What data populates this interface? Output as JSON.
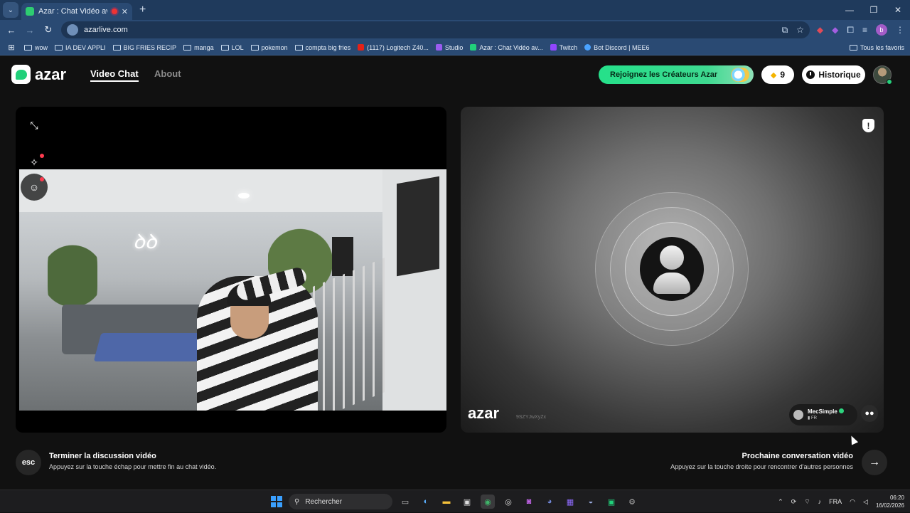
{
  "browser": {
    "tab_title": "Azar : Chat Vidéo avec de n",
    "tab_close": "✕",
    "new_tab": "+",
    "url": "azarlive.com",
    "window_controls": [
      "—",
      "❐",
      "✕"
    ],
    "bookmarks": [
      {
        "label": "wow",
        "icon": "folder-icon"
      },
      {
        "label": "IA DEV APPLI",
        "icon": "folder-icon"
      },
      {
        "label": "BIG FRIES RECIP",
        "icon": "folder-icon"
      },
      {
        "label": "manga",
        "icon": "folder-icon"
      },
      {
        "label": "LOL",
        "icon": "folder-icon"
      },
      {
        "label": "pokemon",
        "icon": "folder-icon"
      },
      {
        "label": "compta big fries",
        "icon": "folder-icon"
      },
      {
        "label": "(1117) Logitech Z40...",
        "icon": "youtube-icon",
        "color": "#e62117"
      },
      {
        "label": "Studio",
        "icon": "studio-icon",
        "color": "#9a5cf0"
      },
      {
        "label": "Azar : Chat Vidéo av...",
        "icon": "azar-icon",
        "color": "#21d07a"
      },
      {
        "label": "Twitch",
        "icon": "twitch-icon",
        "color": "#9146ff"
      },
      {
        "label": "Bot Discord | MEE6",
        "icon": "mee6-icon",
        "color": "#4aa3ff"
      }
    ],
    "all_bookmarks": "Tous les favoris",
    "profile_initial": "b"
  },
  "header": {
    "logo_text": "azar",
    "nav": {
      "video_chat": "Video Chat",
      "about": "About"
    },
    "creators_button": "Rejoignez les Créateurs Azar",
    "gems_count": "9",
    "history_button": "Historique"
  },
  "left_panel": {
    "neon_sign": "ꝺꝺ"
  },
  "right_panel": {
    "watermark": "azar",
    "room_id": "9SZYJwXyZx",
    "peer": {
      "name": "MecSimple",
      "country": "FR",
      "verified": true
    }
  },
  "actions": {
    "end": {
      "key": "esc",
      "title": "Terminer la discussion vidéo",
      "subtitle": "Appuyez sur la touche échap pour mettre fin au chat vidéo."
    },
    "next": {
      "title": "Prochaine conversation vidéo",
      "subtitle": "Appuyez sur la touche droite pour rencontrer d'autres personnes"
    }
  },
  "taskbar": {
    "search_placeholder": "Rechercher",
    "language": "FRA",
    "time": "06:20",
    "date": "16/02/2026"
  },
  "colors": {
    "accent_green": "#21d07a",
    "tab_bg": "#2a4a73",
    "page_bg": "#111111"
  }
}
